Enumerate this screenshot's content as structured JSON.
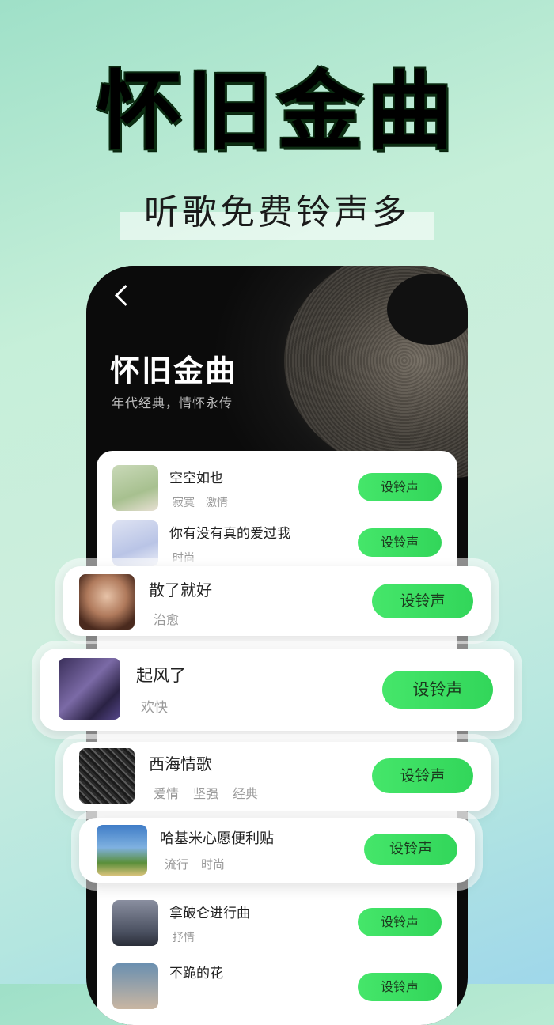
{
  "hero": {
    "title": "怀旧金曲",
    "subtitle": "听歌免费铃声多"
  },
  "phone": {
    "title": "怀旧金曲",
    "subtitle": "年代经典，情怀永传",
    "back_icon": "chevron-left-icon"
  },
  "button_label": "设铃声",
  "songs": [
    {
      "title": "空空如也",
      "tags": [
        "寂寞",
        "激情"
      ]
    },
    {
      "title": "你有没有真的爱过我",
      "tags": [
        "时尚"
      ]
    },
    {
      "title": "散了就好",
      "tags": [
        "治愈"
      ]
    },
    {
      "title": "起风了",
      "tags": [
        "欢快"
      ]
    },
    {
      "title": "西海情歌",
      "tags": [
        "爱情",
        "坚强",
        "经典"
      ]
    },
    {
      "title": "哈基米心愿便利贴",
      "tags": [
        "流行",
        "时尚"
      ]
    },
    {
      "title": "拿破仑进行曲",
      "tags": [
        "抒情"
      ]
    },
    {
      "title": "不跪的花",
      "tags": []
    }
  ],
  "colors": {
    "accent_green": "#3ddc61",
    "title_green": "#1f6e2e",
    "text_dark": "#222222",
    "tag_gray": "#9a9a9a"
  }
}
